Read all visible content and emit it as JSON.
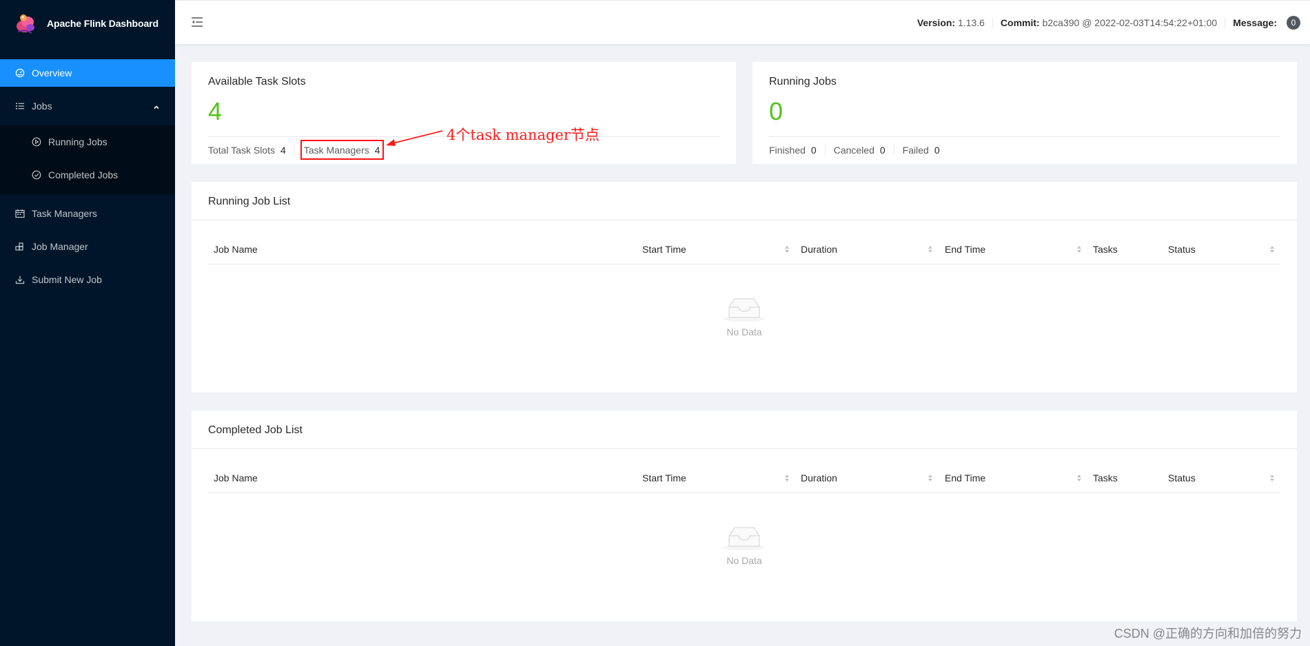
{
  "app": {
    "title": "Apache Flink Dashboard"
  },
  "sidebar": {
    "items": [
      {
        "label": "Overview",
        "icon": "dashboard-icon"
      },
      {
        "label": "Jobs",
        "icon": "list-icon"
      },
      {
        "label": "Running Jobs",
        "icon": "play-circle-icon"
      },
      {
        "label": "Completed Jobs",
        "icon": "check-circle-icon"
      },
      {
        "label": "Task Managers",
        "icon": "schedule-icon"
      },
      {
        "label": "Job Manager",
        "icon": "build-icon"
      },
      {
        "label": "Submit New Job",
        "icon": "upload-icon"
      }
    ]
  },
  "header": {
    "version_label": "Version:",
    "version_value": "1.13.6",
    "commit_label": "Commit:",
    "commit_value": "b2ca390 @ 2022-02-03T14:54:22+01:00",
    "message_label": "Message:",
    "message_count": "0"
  },
  "task_slots": {
    "title": "Available Task Slots",
    "value": "4",
    "total_label": "Total Task Slots",
    "total_value": "4",
    "tm_label": "Task Managers",
    "tm_value": "4"
  },
  "running_jobs": {
    "title": "Running Jobs",
    "value": "0",
    "finished_label": "Finished",
    "finished_value": "0",
    "canceled_label": "Canceled",
    "canceled_value": "0",
    "failed_label": "Failed",
    "failed_value": "0"
  },
  "annotation": {
    "text": "4个task manager节点"
  },
  "running_list": {
    "title": "Running Job List",
    "columns": [
      "Job Name",
      "Start Time",
      "Duration",
      "End Time",
      "Tasks",
      "Status"
    ],
    "empty_text": "No Data"
  },
  "completed_list": {
    "title": "Completed Job List",
    "columns": [
      "Job Name",
      "Start Time",
      "Duration",
      "End Time",
      "Tasks",
      "Status"
    ],
    "empty_text": "No Data"
  },
  "watermark": "CSDN @正确的方向和加倍的努力",
  "colors": {
    "sidebar_bg": "#001529",
    "active": "#1890ff",
    "stat_green": "#52c41a",
    "annotation_red": "#ff1a1a"
  }
}
